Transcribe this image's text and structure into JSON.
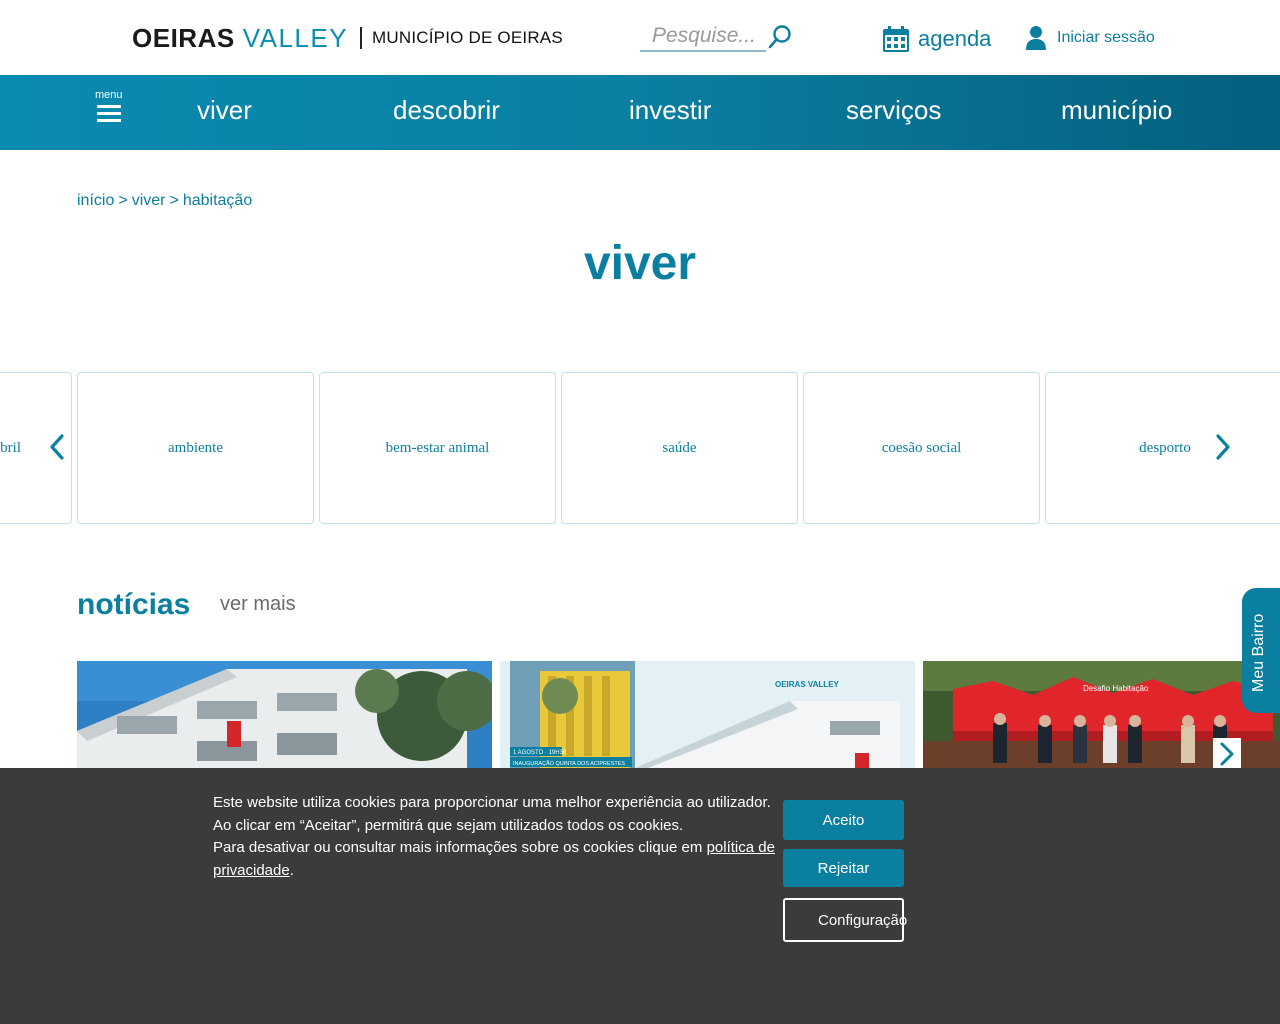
{
  "header": {
    "logo_oeiras": "OEIRAS",
    "logo_valley": "VALLEY",
    "logo_municipio": "MUNICÍPIO DE OEIRAS",
    "search_placeholder": "Pesquise...",
    "agenda_label": "agenda",
    "login_label": "Iniciar sessão"
  },
  "nav": {
    "menu_label": "menu",
    "items": [
      "viver",
      "descobrir",
      "investir",
      "serviços",
      "município"
    ]
  },
  "breadcrumb": [
    "início",
    "viver",
    "habitação"
  ],
  "breadcrumb_sep": ">",
  "page_title": "viver",
  "carousel": {
    "partial_left_label": "bril",
    "items": [
      "ambiente",
      "bem-estar animal",
      "saúde",
      "coesão social",
      "desporto"
    ]
  },
  "news": {
    "title": "notícias",
    "more_label": "ver mais",
    "image2_badge_line1": "1 AGOSTO · 19H30",
    "image2_badge_line2": "INAUGURAÇÃO QUINTA DOS ACIPRESTES",
    "image2_logo": "OEIRAS VALLEY",
    "image3_banner": "Desafio Habitação"
  },
  "side_tab": {
    "label": "Meu Bairro"
  },
  "cookie": {
    "line1": "Este website utiliza cookies para proporcionar uma melhor experiência ao utilizador.",
    "line2": "Ao clicar em “Aceitar”, permitirá que sejam utilizados todos os cookies.",
    "line3": "Para desativar ou consultar mais informações sobre os cookies clique em ",
    "link": "política de privacidade",
    "end": ".",
    "accept": "Aceito",
    "reject": "Rejeitar",
    "config": "Configuração"
  },
  "colors": {
    "brand": "#0b7fa0",
    "nav_gradient_start": "#0b8ab0",
    "nav_gradient_end": "#055f7e",
    "cookie_bg": "#3b3b3b"
  },
  "icons": [
    "search-icon",
    "calendar-icon",
    "user-icon",
    "hamburger-icon",
    "chevron-left-icon",
    "chevron-right-icon"
  ]
}
